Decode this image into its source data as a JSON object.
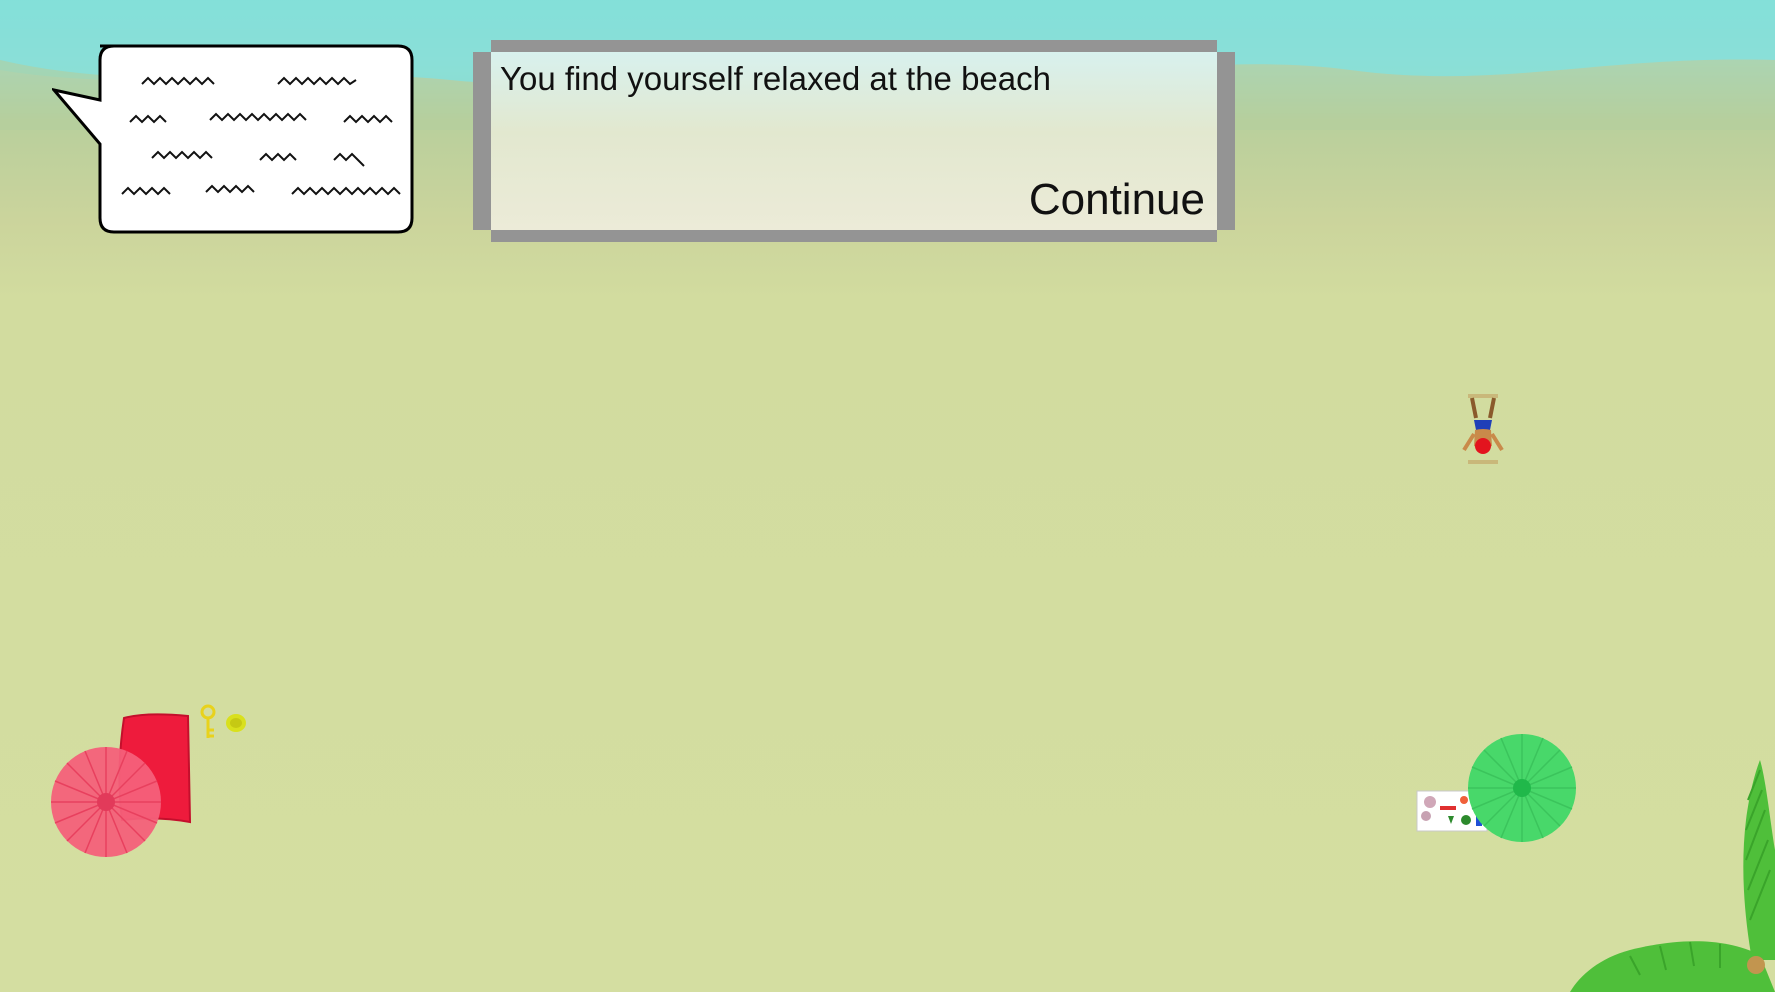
{
  "dialog": {
    "message": "You find yourself relaxed at the beach",
    "continue_label": "Continue"
  },
  "colors": {
    "sky": "#7fded8",
    "sand": "#d4dea1",
    "dialog_frame": "#949494",
    "umbrella_pink": "#f4607a",
    "towel_red": "#ee1b3c",
    "umbrella_green": "#48d86a",
    "palm_green": "#4fbf3a"
  },
  "icons": {
    "speech_bubble": "speech-bubble-icon",
    "key": "key-icon",
    "coin": "coin-icon"
  }
}
